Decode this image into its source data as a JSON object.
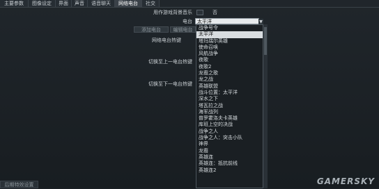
{
  "tabs": [
    {
      "label": "主要参数"
    },
    {
      "label": "图像设定"
    },
    {
      "label": "界面"
    },
    {
      "label": "声音"
    },
    {
      "label": "语音聊天"
    },
    {
      "label": "网络电台"
    },
    {
      "label": "社交"
    }
  ],
  "active_tab": "网络电台",
  "music_toggle": {
    "label": "用作游戏背景音乐",
    "value": "否"
  },
  "radio": {
    "label": "电台",
    "selected": "太平洋"
  },
  "buttons": {
    "add": "添加电台",
    "edit": "编辑电台"
  },
  "hotkeys": {
    "play": "网络电台热键",
    "prev": "切换至上一电台热键",
    "next": "切换至下一电台热键"
  },
  "dropdown_items": [
    "战争号令",
    "太平洋",
    "塔玛瑞尔英雄",
    "使命召唤",
    "风航战争",
    "夜歌",
    "夜歌2",
    "龙裔之歌",
    "龙之战",
    "英雄联盟",
    "战斗位置：太平洋",
    "深水之下",
    "塔瓦拉之战",
    "海军战列",
    "普罗霍洛夫卡英雄",
    "库班上空的决战",
    "战争之人",
    "战争之人：突击小队",
    "神界",
    "龙裔",
    "英雄连",
    "英雄连：抵抗前线",
    "英雄连2"
  ],
  "highlighted_item": "太平洋",
  "footer": "后期特效设置",
  "watermark": "GAMERSKY"
}
